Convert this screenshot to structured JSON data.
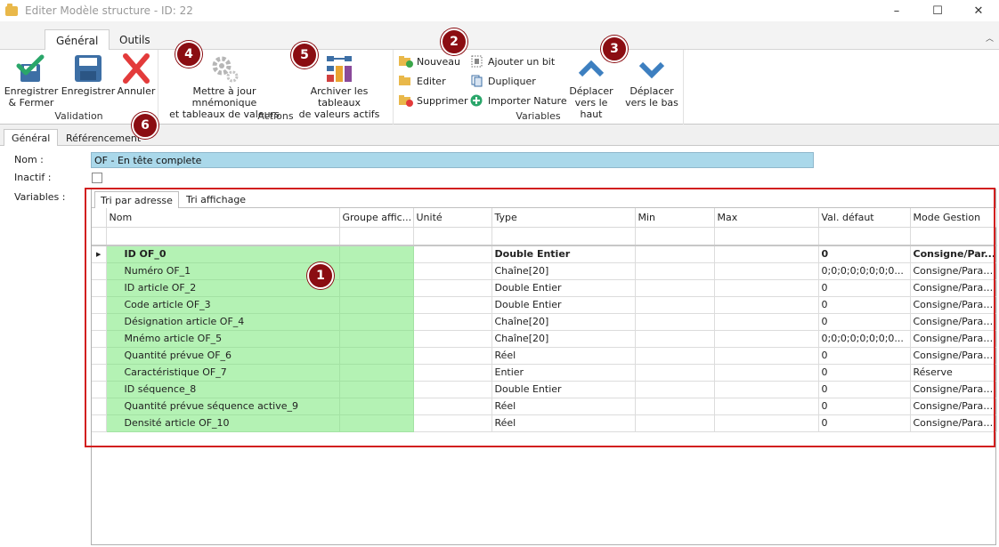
{
  "window": {
    "title": "Editer Modèle structure - ID: 22",
    "minimize": "–",
    "maximize": "☐",
    "close": "✕"
  },
  "ribbon_tabs": [
    "Général",
    "Outils"
  ],
  "ribbon": {
    "validation": {
      "label": "Validation",
      "save_close_line1": "Enregistrer",
      "save_close_line2": "& Fermer",
      "save": "Enregistrer",
      "cancel": "Annuler"
    },
    "actions": {
      "label": "Actions",
      "update_line1": "Mettre à jour mnémonique",
      "update_line2": "et tableaux de valeurs",
      "archive_line1": "Archiver les tableaux",
      "archive_line2": "de valeurs actifs"
    },
    "variables": {
      "label": "Variables",
      "new": "Nouveau",
      "edit": "Editer",
      "delete": "Supprimer",
      "add_bit": "Ajouter un bit",
      "duplicate": "Dupliquer",
      "import_nature": "Importer Nature",
      "move_up_line1": "Déplacer",
      "move_up_line2": "vers le haut",
      "move_down_line1": "Déplacer",
      "move_down_line2": "vers le bas"
    }
  },
  "badges": [
    "1",
    "2",
    "3",
    "4",
    "5",
    "6"
  ],
  "form_tabs": [
    "Général",
    "Référencement"
  ],
  "form": {
    "name_label": "Nom :",
    "name_value": "OF - En tête complete",
    "inactive_label": "Inactif :",
    "variables_label": "Variables :"
  },
  "sub_tabs": [
    "Tri par adresse",
    "Tri affichage"
  ],
  "grid": {
    "columns": [
      "Nom",
      "Groupe affic...",
      "Unité",
      "Type",
      "Min",
      "Max",
      "Val. défaut",
      "Mode Gestion"
    ],
    "row_indicator": "▶",
    "rows": [
      [
        "ID OF_0",
        "",
        "",
        "Double Entier",
        "",
        "",
        "0",
        "Consigne/Par..."
      ],
      [
        "Numéro OF_1",
        "",
        "",
        "Chaîne[20]",
        "",
        "",
        "0;0;0;0;0;0;0;0...",
        "Consigne/Param..."
      ],
      [
        "ID article OF_2",
        "",
        "",
        "Double Entier",
        "",
        "",
        "0",
        "Consigne/Param..."
      ],
      [
        "Code article OF_3",
        "",
        "",
        "Double Entier",
        "",
        "",
        "0",
        "Consigne/Param..."
      ],
      [
        "Désignation article OF_4",
        "",
        "",
        "Chaîne[20]",
        "",
        "",
        "0",
        "Consigne/Param..."
      ],
      [
        "Mnémo article OF_5",
        "",
        "",
        "Chaîne[20]",
        "",
        "",
        "0;0;0;0;0;0;0;0...",
        "Consigne/Param..."
      ],
      [
        "Quantité prévue OF_6",
        "",
        "",
        "Réel",
        "",
        "",
        "0",
        "Consigne/Param..."
      ],
      [
        "Caractéristique OF_7",
        "",
        "",
        "Entier",
        "",
        "",
        "0",
        "Réserve"
      ],
      [
        "ID séquence_8",
        "",
        "",
        "Double Entier",
        "",
        "",
        "0",
        "Consigne/Param..."
      ],
      [
        "Quantité prévue séquence active_9",
        "",
        "",
        "Réel",
        "",
        "",
        "0",
        "Consigne/Param..."
      ],
      [
        "Densité article OF_10",
        "",
        "",
        "Réel",
        "",
        "",
        "0",
        "Consigne/Param..."
      ]
    ]
  },
  "colors": {
    "accent_red": "#8b0d12",
    "frame_red": "#d21f1f",
    "row_green": "#b4f2b4",
    "name_field": "#aad8ea"
  }
}
